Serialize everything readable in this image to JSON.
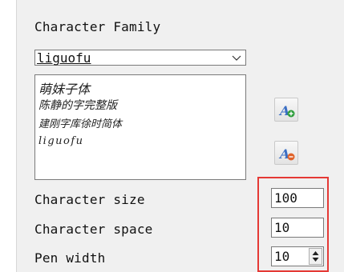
{
  "heading": "Character Family",
  "font_select": {
    "value": "liguofu"
  },
  "font_list": {
    "items": [
      "萌妹子体",
      "陈静的字完整版",
      "建刚字库徐时简体",
      "liguofu"
    ]
  },
  "icons": {
    "add": "add-font-icon",
    "remove": "remove-font-icon"
  },
  "fields": {
    "character_size": {
      "label": "Character size",
      "value": "100"
    },
    "character_space": {
      "label": "Character space",
      "value": "10"
    },
    "pen_width": {
      "label": "Pen width",
      "value": "10"
    }
  },
  "colors": {
    "highlight": "#e53935",
    "add_badge": "#2e9e3c",
    "remove_badge": "#e0632a",
    "icon_a": "#3b6fc4"
  }
}
